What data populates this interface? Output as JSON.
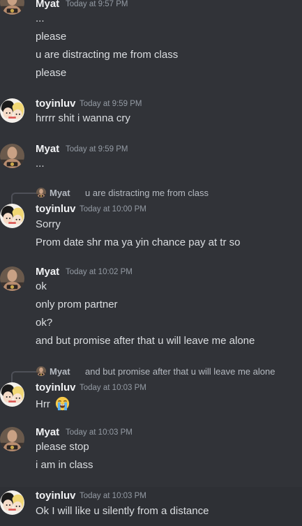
{
  "messages": [
    {
      "author": "Myat",
      "timestamp": "Today at 9:57 PM",
      "lines": [
        "...",
        "please",
        "u are distracting me from class",
        "please"
      ]
    },
    {
      "author": "toyinluv",
      "timestamp": "Today at 9:59 PM",
      "lines": [
        "hrrrr shit i wanna cry"
      ]
    },
    {
      "author": "Myat",
      "timestamp": "Today at 9:59 PM",
      "lines": [
        "..."
      ]
    },
    {
      "reply": {
        "author": "Myat",
        "text": "u are distracting me from class"
      },
      "author": "toyinluv",
      "timestamp": "Today at 10:00 PM",
      "lines": [
        "Sorry",
        "Prom date shr ma ya yin chance pay at tr so"
      ]
    },
    {
      "author": "Myat",
      "timestamp": "Today at 10:02 PM",
      "lines": [
        "ok",
        "only prom partner",
        "ok?",
        "and but promise after that u will leave me alone"
      ]
    },
    {
      "reply": {
        "author": "Myat",
        "text": "and but promise after that u will leave me alone"
      },
      "author": "toyinluv",
      "timestamp": "Today at 10:03 PM",
      "lines": [
        "Hrr"
      ],
      "emoji": "loudly-crying-face"
    },
    {
      "author": "Myat",
      "timestamp": "Today at 10:03 PM",
      "lines": [
        "please stop",
        "i am in class"
      ]
    },
    {
      "author": "toyinluv",
      "timestamp": "Today at 10:03 PM",
      "lines": [
        "Ok I will like u silently from a distance"
      ]
    }
  ],
  "colors": {
    "background": "#313338",
    "text": "#dbdee1",
    "username": "#f2f3f5",
    "timestamp": "#949ba4",
    "reply_text": "#b5bac1"
  }
}
